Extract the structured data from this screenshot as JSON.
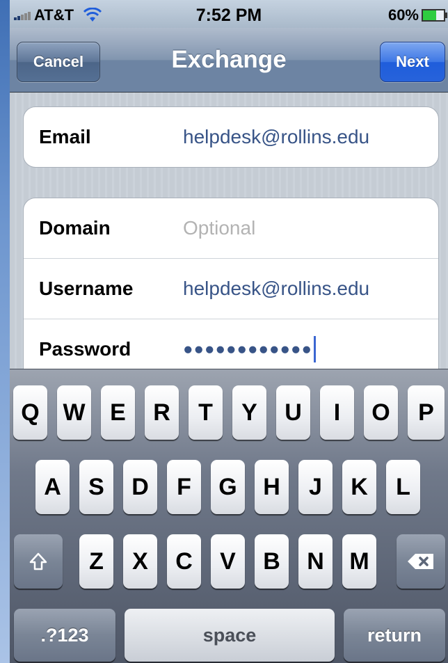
{
  "status_bar": {
    "carrier": "AT&T",
    "time": "7:52 PM",
    "battery": "60%",
    "icons": [
      "signal-icon",
      "wifi-icon",
      "battery-icon"
    ]
  },
  "nav": {
    "title": "Exchange",
    "cancel_label": "Cancel",
    "next_label": "Next"
  },
  "form": {
    "email_label": "Email",
    "email_value": "helpdesk@rollins.edu",
    "domain_label": "Domain",
    "domain_placeholder": "Optional",
    "username_label": "Username",
    "username_value": "helpdesk@rollins.edu",
    "password_label": "Password",
    "password_masked": "●●●●●●●●●●●●"
  },
  "keyboard": {
    "row1": [
      "Q",
      "W",
      "E",
      "R",
      "T",
      "Y",
      "U",
      "I",
      "O",
      "P"
    ],
    "row2": [
      "A",
      "S",
      "D",
      "F",
      "G",
      "H",
      "J",
      "K",
      "L"
    ],
    "row3": [
      "Z",
      "X",
      "C",
      "V",
      "B",
      "N",
      "M"
    ],
    "mode_label": ".?123",
    "space_label": "space",
    "return_label": "return",
    "shift_icon": "shift-icon",
    "delete_icon": "backspace-icon"
  },
  "colors": {
    "accent_blue": "#2763db",
    "field_value": "#385487",
    "placeholder": "#b3b3b3",
    "caret": "#3b66d1"
  }
}
